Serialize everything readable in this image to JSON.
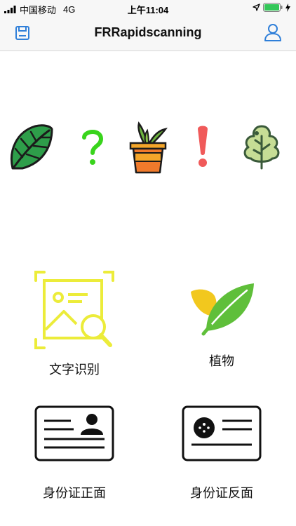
{
  "status_bar": {
    "carrier": "中国移动",
    "network": "4G",
    "time": "上午11:04"
  },
  "nav": {
    "title": "FRRapidscanning",
    "left_icon": "save-icon",
    "right_icon": "user-icon",
    "accent": "#2f7fd9"
  },
  "decor_icons": [
    "monstera-leaf-icon",
    "question-mark-icon",
    "potted-plant-icon",
    "exclamation-mark-icon",
    "tree-icon"
  ],
  "menu": {
    "items": [
      {
        "label": "文字识别",
        "icon": "text-scan-icon"
      },
      {
        "label": "植物",
        "icon": "leaf-icon"
      },
      {
        "label": "身份证正面",
        "icon": "id-card-front-icon"
      },
      {
        "label": "身份证反面",
        "icon": "id-card-back-icon"
      }
    ]
  }
}
